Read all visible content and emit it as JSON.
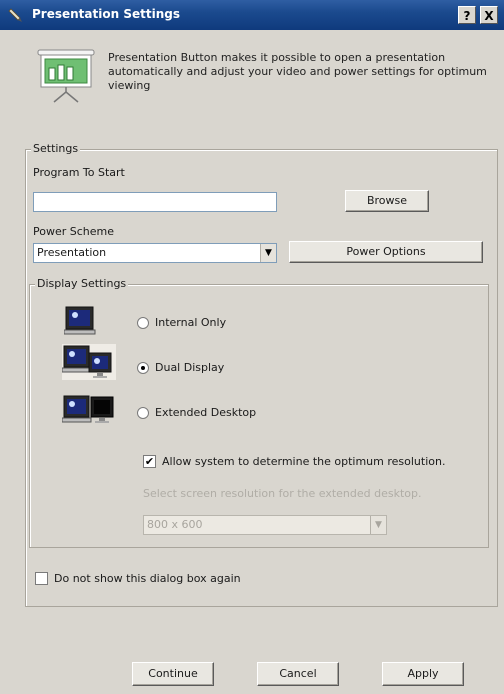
{
  "window": {
    "title": "Presentation Settings",
    "help_glyph": "?",
    "close_glyph": "X"
  },
  "intro": {
    "text": "Presentation Button makes it possible to open a presentation automatically and adjust your video and power settings for optimum viewing",
    "icon": "presentation-screen-icon"
  },
  "settings": {
    "legend": "Settings",
    "program_label": "Program To Start",
    "program_value": "",
    "browse_label": "Browse",
    "power_label": "Power Scheme",
    "power_value": "Presentation",
    "power_options_label": "Power Options"
  },
  "display": {
    "legend": "Display Settings",
    "options": [
      {
        "label": "Internal Only",
        "selected": false,
        "icon": "laptop-icon"
      },
      {
        "label": "Dual Display",
        "selected": true,
        "icon": "dual-display-icon"
      },
      {
        "label": "Extended Desktop",
        "selected": false,
        "icon": "extended-desktop-icon"
      }
    ],
    "auto_resolution_label": "Allow system to determine the optimum resolution.",
    "auto_resolution_checked": true,
    "resolution_hint": "Select screen resolution for the extended desktop.",
    "resolution_value": "800 x 600"
  },
  "dont_show": {
    "label": "Do not show this dialog box again",
    "checked": false
  },
  "buttons": {
    "continue": "Continue",
    "cancel": "Cancel",
    "apply": "Apply"
  },
  "colors": {
    "titlebar": "#1b4a8e",
    "dialog_bg": "#d9d6cf",
    "field_border": "#7f9db9"
  }
}
